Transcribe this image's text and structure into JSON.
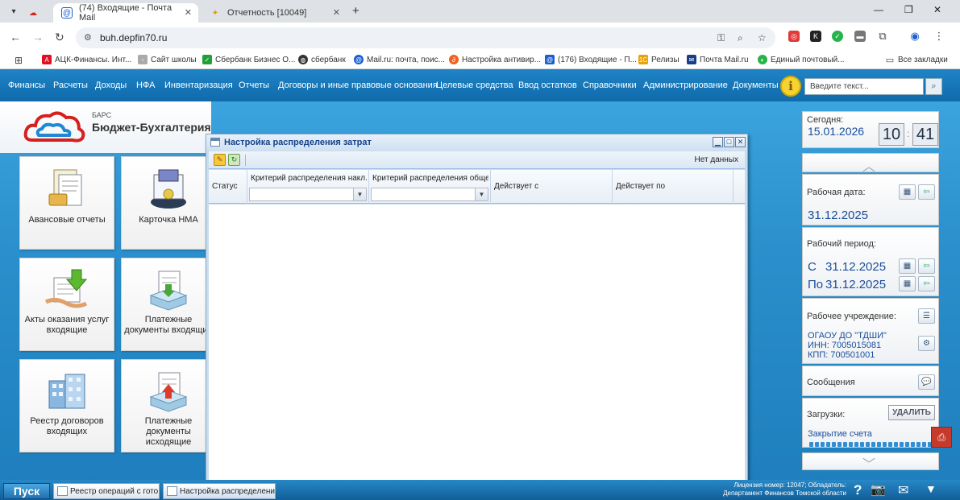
{
  "browser": {
    "tabs": [
      {
        "title": "(74) Входящие - Почта Mail",
        "active": true
      },
      {
        "title": "Отчетность [10049]",
        "active": false
      }
    ],
    "url": "buh.depfin70.ru",
    "bookmarks": [
      "АЦК-Финансы. Инт...",
      "Сайт школы",
      "Сбербанк Бизнес О...",
      "сбербанк",
      "Mail.ru: почта, поис...",
      "Настройка антивир...",
      "(176) Входящие - П...",
      "Релизы",
      "Почта Mail.ru",
      "Единый почтовый..."
    ],
    "all_bookmarks": "Все закладки"
  },
  "app": {
    "menu": [
      "Финансы",
      "Расчеты",
      "Доходы",
      "НФА",
      "Инвентаризация",
      "Отчеты",
      "Договоры и иные правовые основания",
      "Целевые средства",
      "Ввод остатков",
      "Справочники",
      "Администрирование",
      "Документы"
    ],
    "search_placeholder": "Введите текст...",
    "logo": {
      "small": "БАРС",
      "big": "Бюджет-Бухгалтерия"
    },
    "tiles": [
      {
        "label": "Авансовые отчеты",
        "icon": "advance-report-icon"
      },
      {
        "label": "Карточка НМА",
        "icon": "card-file-icon"
      },
      {
        "label": "Акты оказания услуг входящие",
        "icon": "service-acts-icon"
      },
      {
        "label": "Платежные документы входящие",
        "icon": "payment-in-icon"
      },
      {
        "label": "Реестр договоров входящих",
        "icon": "contracts-registry-icon"
      },
      {
        "label": "Платежные документы исходящие",
        "icon": "payment-out-icon"
      }
    ],
    "dialog": {
      "title": "Настройка распределения затрат",
      "no_data": "Нет данных",
      "columns": [
        "Статус",
        "Критерий распределения накл...",
        "Критерий распределения обще...",
        "Действует с",
        "Действует по"
      ]
    },
    "right": {
      "today_label": "Сегодня:",
      "today_date": "15.01.2026",
      "hours": "10",
      "minutes": "41",
      "work_date_label": "Рабочая дата:",
      "work_date": "31.12.2025",
      "period_label": "Рабочий период:",
      "period_from_prefix": "С",
      "period_from": "31.12.2025",
      "period_to_prefix": "По",
      "period_to": "31.12.2025",
      "org_label": "Рабочее учреждение:",
      "org_name": "ОГАОУ ДО \"ТДШИ\"",
      "org_inn": "ИНН: 7005015081",
      "org_kpp": "КПП: 700501001",
      "messages_label": "Сообщения",
      "downloads_label": "Загрузки:",
      "delete_button": "УДАЛИТЬ",
      "download_item": "Закрытие счета"
    }
  },
  "taskbar": {
    "start": "Пуск",
    "tasks": [
      "Реестр операций с гото...",
      "Настройка распределени..."
    ],
    "license_line1": "Лицензия номер: 12047; Обладатель:",
    "license_line2": "Департамент Финансов Томской области"
  },
  "colors": {
    "menubar": "#0f6aab",
    "accent_blue": "#1a4d9a",
    "dialog_title": "#15428b"
  }
}
